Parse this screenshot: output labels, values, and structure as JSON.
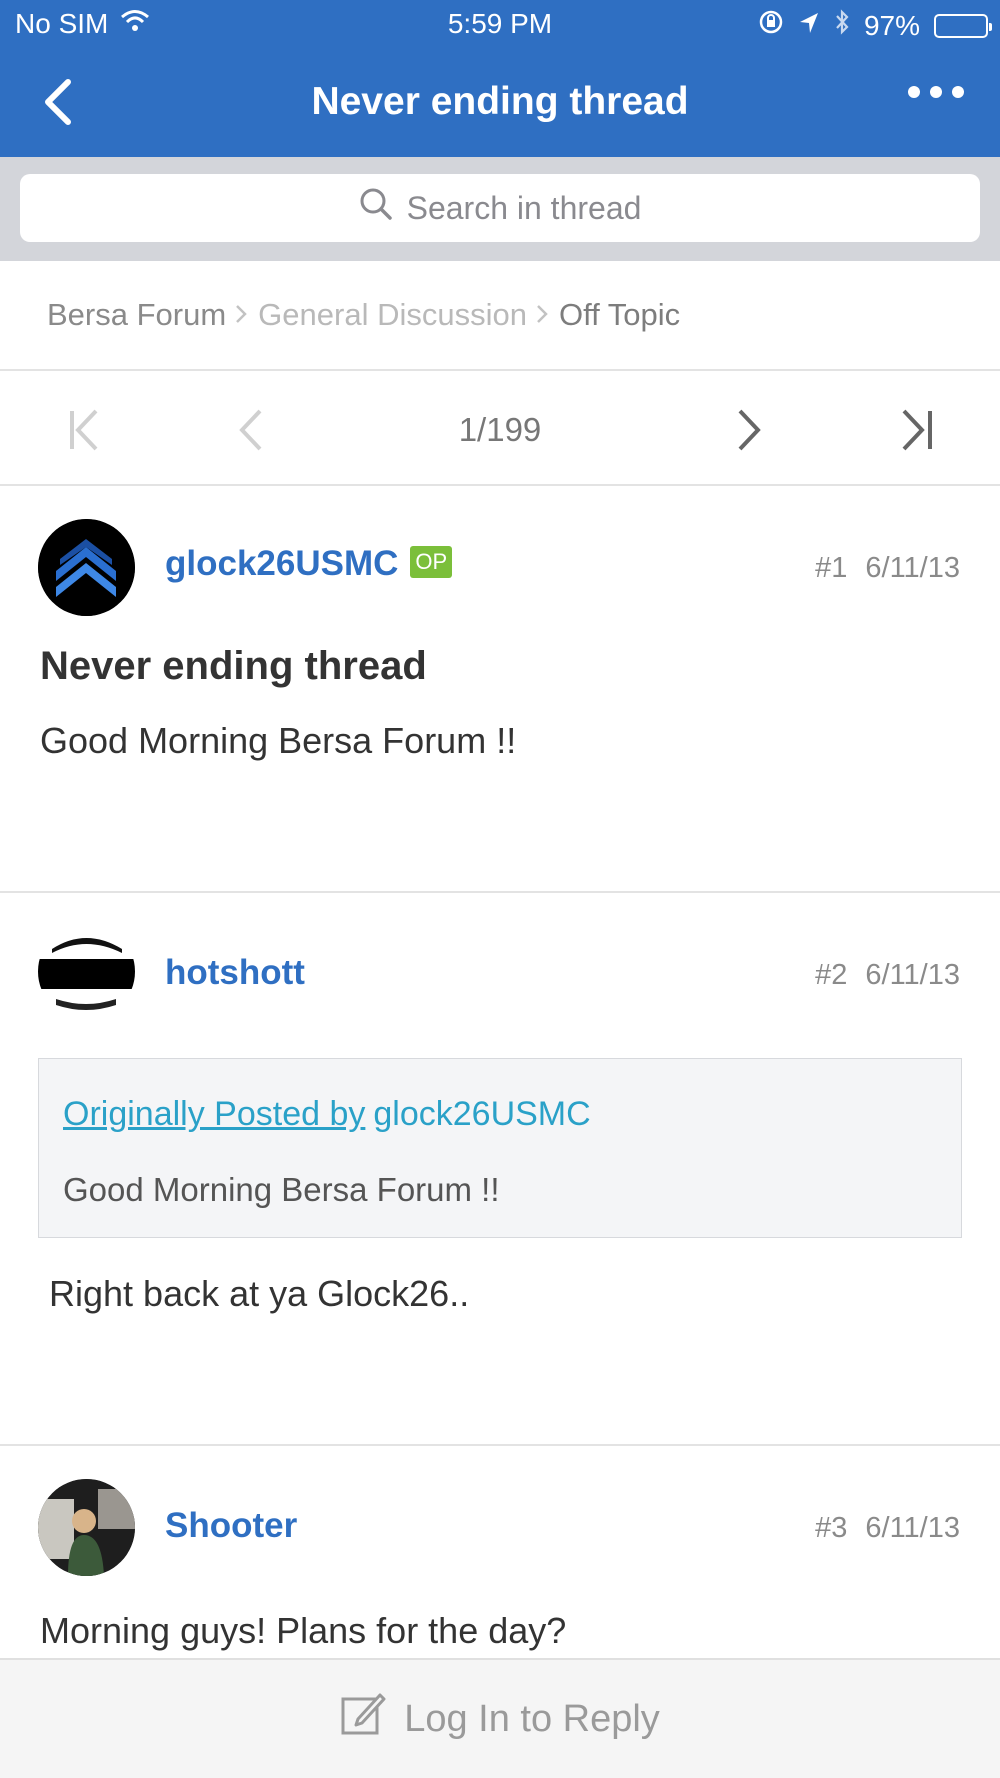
{
  "status_bar": {
    "carrier": "No SIM",
    "time": "5:59 PM",
    "battery_percent": "97%",
    "battery_level": 0.97
  },
  "nav": {
    "title": "Never ending thread",
    "back_icon": "chevron-left-icon",
    "more_icon": "ellipsis-icon"
  },
  "search": {
    "placeholder": "Search in thread"
  },
  "breadcrumb": [
    {
      "label": "Bersa Forum"
    },
    {
      "label": "General Discussion"
    },
    {
      "label": "Off Topic"
    }
  ],
  "pagination": {
    "page_indicator": "1/199"
  },
  "posts": [
    {
      "username": "glock26USMC",
      "badge": "OP",
      "number": "#1",
      "date": "6/11/13",
      "title": "Never ending thread",
      "body": "Good Morning Bersa Forum !!"
    },
    {
      "username": "hotshott",
      "number": "#2",
      "date": "6/11/13",
      "quote": {
        "prefix": "Originally Posted by",
        "author": "glock26USMC",
        "text": "Good Morning Bersa Forum !!"
      },
      "body": "Right back at ya Glock26.."
    },
    {
      "username": "Shooter",
      "number": "#3",
      "date": "6/11/13",
      "body": "Morning guys! Plans for the day?"
    }
  ],
  "reply": {
    "label": "Log In to Reply",
    "icon": "compose-icon"
  },
  "colors": {
    "brand": "#2f6fc2",
    "op_badge": "#7bbf3a",
    "quote_link": "#2aa1c8"
  }
}
